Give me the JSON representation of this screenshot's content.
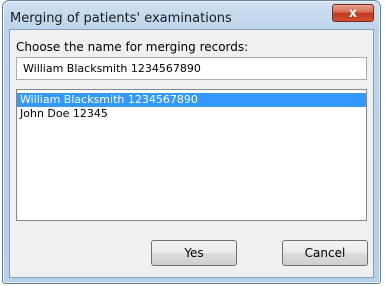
{
  "window": {
    "title": "Merging of patients' examinations",
    "close_symbol": "x"
  },
  "form": {
    "prompt_label": "Choose the name for merging records:",
    "name_value": "William Blacksmith 1234567890"
  },
  "record_list": {
    "items": [
      {
        "label": "William Blacksmith 1234567890",
        "selected": true
      },
      {
        "label": "John Doe 12345",
        "selected": false
      }
    ]
  },
  "buttons": {
    "yes_label": "Yes",
    "cancel_label": "Cancel"
  },
  "colors": {
    "selection": "#3399ff",
    "close_button": "#c2391f"
  },
  "icons": {
    "close": "close-icon"
  }
}
